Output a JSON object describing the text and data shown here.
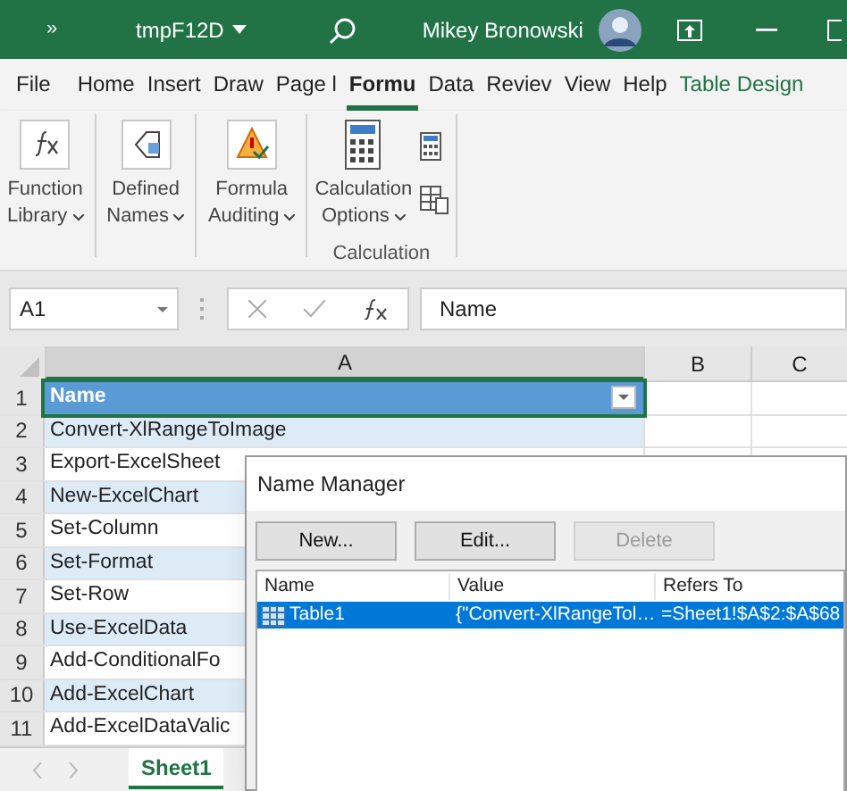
{
  "title_bar": {
    "overflow": "»",
    "file_name": "tmpF12D",
    "user_name": "Mikey Bronowski"
  },
  "ribbon_tabs": [
    {
      "label": "File",
      "selected": false,
      "kind": "normal"
    },
    {
      "label": "Home",
      "selected": false,
      "kind": "normal"
    },
    {
      "label": "Insert",
      "selected": false,
      "kind": "normal"
    },
    {
      "label": "Draw",
      "selected": false,
      "kind": "normal"
    },
    {
      "label": "Page l",
      "selected": false,
      "kind": "normal"
    },
    {
      "label": "Formu",
      "selected": true,
      "kind": "normal"
    },
    {
      "label": "Data",
      "selected": false,
      "kind": "normal"
    },
    {
      "label": "Reviev",
      "selected": false,
      "kind": "normal"
    },
    {
      "label": "View",
      "selected": false,
      "kind": "normal"
    },
    {
      "label": "Help",
      "selected": false,
      "kind": "normal"
    },
    {
      "label": "Table Design",
      "selected": false,
      "kind": "contextual"
    }
  ],
  "ribbon_buttons": [
    {
      "kind": "function",
      "lines": [
        "Function",
        "Library"
      ]
    },
    {
      "kind": "names",
      "lines": [
        "Defined",
        "Names"
      ]
    },
    {
      "kind": "auditing",
      "lines": [
        "Formula",
        "Auditing"
      ]
    }
  ],
  "calculation_group": {
    "options_lines": [
      "Calculation",
      "Options"
    ],
    "group_label": "Calculation"
  },
  "formula_bar": {
    "name_box": "A1",
    "formula": "Name"
  },
  "columns": [
    {
      "label": "A",
      "selected": true
    },
    {
      "label": "B",
      "selected": false
    },
    {
      "label": "C",
      "selected": false
    }
  ],
  "rows": [
    {
      "number": "1",
      "text": "Name",
      "kind": "header",
      "selected": true,
      "banded": false
    },
    {
      "number": "2",
      "text": "Convert-XlRangeToImage",
      "kind": "data",
      "selected": false,
      "banded": true
    },
    {
      "number": "3",
      "text": "Export-ExcelSheet",
      "kind": "data",
      "selected": false,
      "banded": false
    },
    {
      "number": "4",
      "text": "New-ExcelChart",
      "kind": "data",
      "selected": false,
      "banded": true
    },
    {
      "number": "5",
      "text": "Set-Column",
      "kind": "data",
      "selected": false,
      "banded": false
    },
    {
      "number": "6",
      "text": "Set-Format",
      "kind": "data",
      "selected": false,
      "banded": true
    },
    {
      "number": "7",
      "text": "Set-Row",
      "kind": "data",
      "selected": false,
      "banded": false
    },
    {
      "number": "8",
      "text": "Use-ExcelData",
      "kind": "data",
      "selected": false,
      "banded": true
    },
    {
      "number": "9",
      "text": "Add-ConditionalFo",
      "kind": "data",
      "selected": false,
      "banded": false
    },
    {
      "number": "10",
      "text": "Add-ExcelChart",
      "kind": "data",
      "selected": false,
      "banded": true
    },
    {
      "number": "11",
      "text": "Add-ExcelDataValic",
      "kind": "data",
      "selected": false,
      "banded": false
    }
  ],
  "sheet_tabs": [
    {
      "label": "Sheet1",
      "selected": true
    }
  ],
  "dialog": {
    "title": "Name Manager",
    "buttons": [
      {
        "label": "New...",
        "disabled": false
      },
      {
        "label": "Edit...",
        "disabled": false
      },
      {
        "label": "Delete",
        "disabled": true
      }
    ],
    "columns": [
      "Name",
      "Value",
      "Refers To"
    ],
    "names": [
      {
        "name": "Table1",
        "value": "{\"Convert-XlRangeTol…",
        "refers_to": "=Sheet1!$A$2:$A$68",
        "selected": true
      }
    ]
  }
}
